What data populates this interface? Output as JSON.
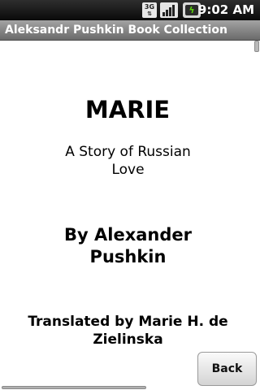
{
  "status_bar": {
    "network_label": "3G",
    "time": "9:02 AM",
    "icons": [
      "3g-icon",
      "signal-icon",
      "battery-charging-icon"
    ],
    "background_color": "#111111"
  },
  "title_bar": {
    "title": "Aleksandr Pushkin Book Collection",
    "background_color": "#8a8a8a"
  },
  "book": {
    "title": "MARIE",
    "subtitle": "A Story of Russian Love",
    "author": "By Alexander Pushkin",
    "translator": "Translated by Marie H. de Zielinska"
  },
  "actions": {
    "back_label": "Back"
  }
}
